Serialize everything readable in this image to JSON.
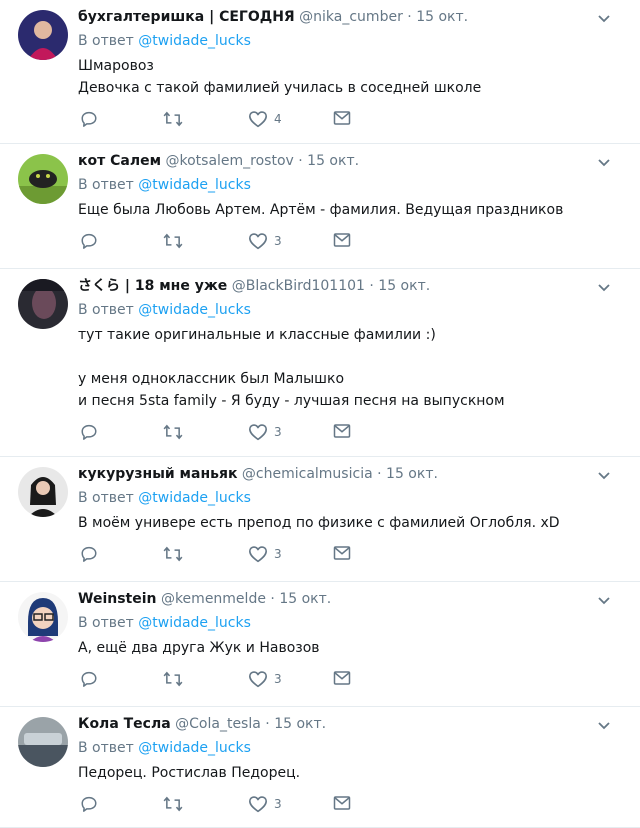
{
  "reply_prefix": "В ответ",
  "separator": "·",
  "tweets": [
    {
      "name": "бухгалтеришка | СЕГОДНЯ",
      "handle": "@nika_cumber",
      "date": "15 окт.",
      "reply_to": "@twidade_lucks",
      "lines": [
        "Шмаровоз",
        "Девочка с такой фамилией училась в соседней школе"
      ],
      "likes": "4",
      "avatar_colors": [
        "#2b2a6e",
        "#c2185b"
      ]
    },
    {
      "name": "кот Салем",
      "handle": "@kotsalem_rostov",
      "date": "15 окт.",
      "reply_to": "@twidade_lucks",
      "lines": [
        "Еще была Любовь Артем. Артём - фамилия. Ведущая праздников"
      ],
      "likes": "3",
      "avatar_colors": [
        "#8bc34a",
        "#222222"
      ]
    },
    {
      "name": "さくら | 18 мне уже",
      "handle": "@BlackBird101101",
      "date": "15 окт.",
      "reply_to": "@twidade_lucks",
      "lines": [
        "тут такие оригинальные и классные фамилии :)",
        "",
        "у меня одноклассник был Малышко",
        "и песня 5sta family - Я буду - лучшая песня на выпускном"
      ],
      "likes": "3",
      "avatar_colors": [
        "#2a2a32",
        "#6a4a5a"
      ]
    },
    {
      "name": "кукурузный маньяк",
      "handle": "@chemicalmusicia",
      "date": "15 окт.",
      "reply_to": "@twidade_lucks",
      "lines": [
        "В моём универе есть препод по физике с фамилией Оглобля. xD"
      ],
      "likes": "3",
      "avatar_colors": [
        "#e8e8e8",
        "#1a1a1a"
      ]
    },
    {
      "name": "Weinstein",
      "handle": "@kemenmelde",
      "date": "15 окт.",
      "reply_to": "@twidade_lucks",
      "lines": [
        "А, ещё два друга Жук и Навозов"
      ],
      "likes": "3",
      "avatar_colors": [
        "#f5f5f5",
        "#1e3a78"
      ]
    },
    {
      "name": "Кола Тесла",
      "handle": "@Cola_tesla",
      "date": "15 окт.",
      "reply_to": "@twidade_lucks",
      "lines": [
        "Педорец. Ростислав Педорец."
      ],
      "likes": "3",
      "avatar_colors": [
        "#9aa3a8",
        "#4a5560"
      ]
    }
  ]
}
